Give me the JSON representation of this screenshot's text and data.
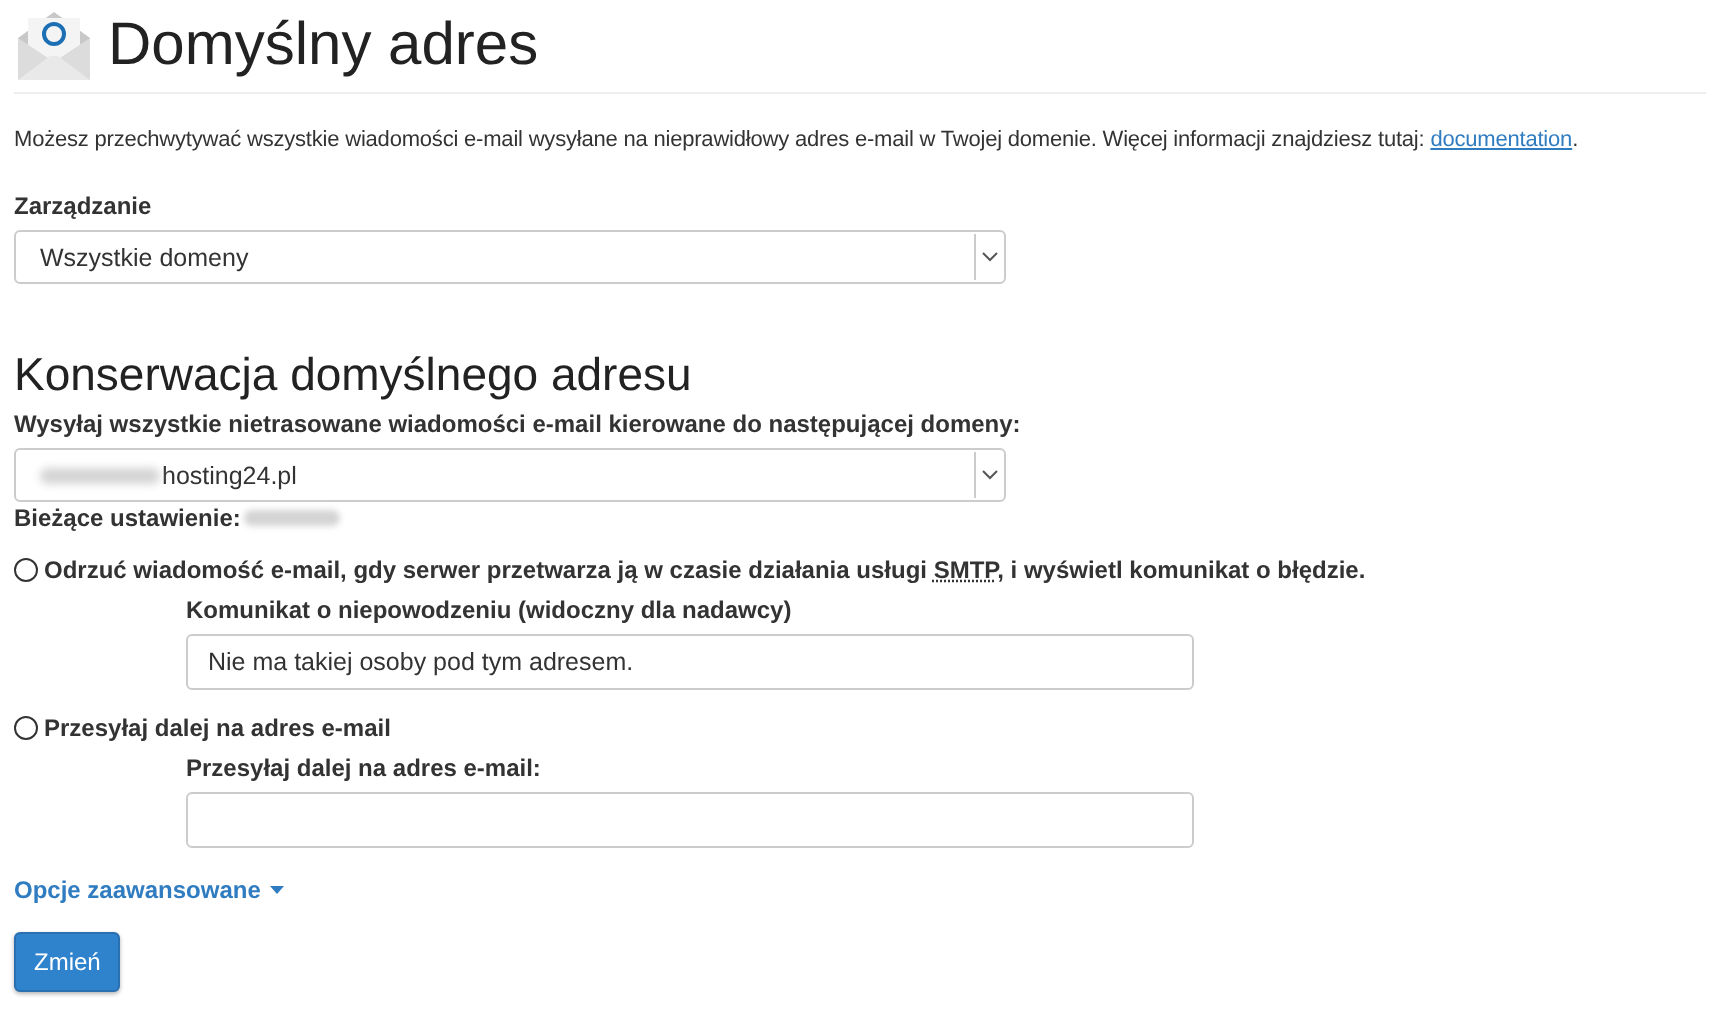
{
  "page": {
    "title": "Domyślny adres"
  },
  "intro": {
    "text": "Możesz przechwytywać wszystkie wiadomości e-mail wysyłane na nieprawidłowy adres e-mail w Twojej domenie. Więcej informacji znajdziesz tutaj:",
    "link": "documentation",
    "suffix": "."
  },
  "manage": {
    "label": "Zarządzanie",
    "value": "Wszystkie domeny"
  },
  "section": {
    "title": "Konserwacja domyślnego adresu",
    "domain_label": "Wysyłaj wszystkie nietrasowane wiadomości e-mail kierowane do następującej domeny:",
    "domain_value": "hosting24.pl",
    "current_label": "Bieżące ustawienie:"
  },
  "options": [
    {
      "kind": "message",
      "selected": false,
      "label_before": "Odrzuć wiadomość e-mail, gdy serwer przetwarza ją w czasie działania usługi",
      "abbr": "SMTP",
      "label_after": ", i wyświetl komunikat o błędzie.",
      "field_label": "Komunikat o niepowodzeniu (widoczny dla nadawcy)",
      "value": "Nie ma takiej osoby pod tym adresem."
    },
    {
      "kind": "forward",
      "selected": false,
      "label": "Przesyłaj dalej na adres e-mail",
      "field_label": "Przesyłaj dalej na adres e-mail:"
    }
  ],
  "advanced": {
    "label": "Opcje zaawansowane",
    "expanded": false
  },
  "submit": {
    "label": "Zmień"
  }
}
